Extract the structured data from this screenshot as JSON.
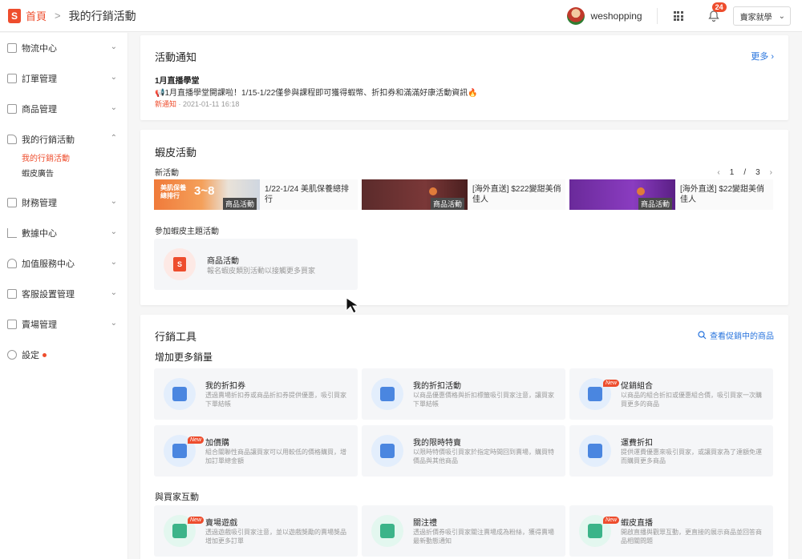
{
  "header": {
    "logo_letter": "S",
    "home": "首頁",
    "separator": ">",
    "current": "我的行銷活動",
    "username": "weshopping",
    "notification_count": "24",
    "seller_center": "賣家就學",
    "dropdown_glyph": "⌄"
  },
  "sidebar": {
    "items": [
      {
        "label": "物流中心",
        "icon": "truck-icon"
      },
      {
        "label": "訂單管理",
        "icon": "clipboard-icon"
      },
      {
        "label": "商品管理",
        "icon": "box-icon"
      },
      {
        "label": "我的行銷活動",
        "icon": "tag-icon"
      },
      {
        "label": "財務管理",
        "icon": "wallet-icon"
      },
      {
        "label": "數據中心",
        "icon": "chart-icon"
      },
      {
        "label": "加值服務中心",
        "icon": "diamond-icon"
      },
      {
        "label": "客服設置管理",
        "icon": "chat-icon"
      },
      {
        "label": "賣場管理",
        "icon": "store-icon"
      },
      {
        "label": "設定",
        "icon": "gear-icon"
      }
    ],
    "sub_items": [
      "我的行銷活動",
      "蝦皮廣告"
    ],
    "chevron_down": "⌄",
    "chevron_up": "⌃"
  },
  "notice": {
    "title": "活動通知",
    "more": "更多",
    "more_arrow": "›",
    "item_title": "1月直播學堂",
    "item_body": "📢1月直播學堂開課啦！1/15-1/22僅參與課程即可獲得蝦幣、折扣券和滿滿好康活動資訊🔥",
    "item_tag": "新通知",
    "item_date": " · 2021-01-11 16:18"
  },
  "shopee_activity": {
    "title": "蝦皮活動",
    "new_label": "新活動",
    "pager": {
      "prev": "‹",
      "current": "1",
      "sep": "/",
      "total": "3",
      "next": "›"
    },
    "banners": [
      {
        "text": "1/22-1/24 美肌保養總排行",
        "tag": "商品活動",
        "image_text": "美肌保養總排行",
        "image_big": "3~8"
      },
      {
        "text": "[海外直送] $222變甜美俏佳人",
        "tag": "商品活動"
      },
      {
        "text": "[海外直送] $22變甜美俏佳人",
        "tag": "商品活動"
      }
    ],
    "theme_label": "參加蝦皮主題活動",
    "theme": {
      "name": "商品活動",
      "desc": "報名蝦皮類別活動以接觸更多買家",
      "icon_letter": "S"
    }
  },
  "tools": {
    "title": "行銷工具",
    "search_promo": "查看促銷中的商品",
    "group1": "增加更多銷量",
    "group2": "與買家互動",
    "new_badge": "New",
    "items": [
      {
        "name": "我的折扣券",
        "desc": "透過賣場折扣券或商品折扣券提供優惠，吸引買家下單結帳",
        "icon": "ticket-icon",
        "new": false
      },
      {
        "name": "我的折扣活動",
        "desc": "以商品優惠價格與折扣標籤吸引買家注意，讓買家下單結帳",
        "icon": "price-tag-icon",
        "new": false
      },
      {
        "name": "促銷組合",
        "desc": "以商品的組合折扣或優惠組合價，吸引買家一次購買更多的商品",
        "icon": "bundle-icon",
        "new": true
      },
      {
        "name": "加價購",
        "desc": "組合關聯性商品讓買家可以用較低的價格購買，增加訂單總金額",
        "icon": "cart-plus-icon",
        "new": true
      },
      {
        "name": "我的限時特賣",
        "desc": "以限時特價吸引買家於指定時間回到賣場，購買特價品與其他商品",
        "icon": "flash-sale-icon",
        "new": false
      },
      {
        "name": "運費折扣",
        "desc": "提供運費優惠來吸引買家，或讓買家為了達額免運而購買更多商品",
        "icon": "shipping-icon",
        "new": false
      },
      {
        "name": "賣場遊戲",
        "desc": "透過遊戲吸引買家注意，並以遊戲獎勵的賣場獎品增加更多訂單",
        "icon": "gamepad-icon",
        "new": true
      },
      {
        "name": "關注禮",
        "desc": "透過折價券吸引買家關注賣場成為粉絲，獲得賣場最新動態通知",
        "icon": "gift-icon",
        "new": false
      },
      {
        "name": "蝦皮直播",
        "desc": "開啟直播與觀眾互動，更直接的展示商品並回答商品相關問題",
        "icon": "video-icon",
        "new": true
      }
    ]
  },
  "colors": {
    "accent": "#ee4d2d",
    "link": "#2673dd"
  }
}
